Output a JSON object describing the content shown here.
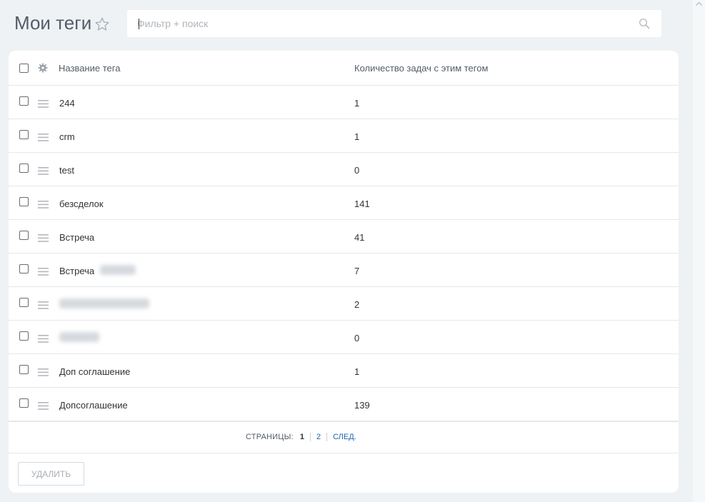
{
  "header": {
    "title": "Мои теги",
    "search_placeholder": "Фильтр + поиск",
    "search_value": ""
  },
  "table": {
    "columns": [
      "Название тега",
      "Количество задач с этим тегом"
    ],
    "rows": [
      {
        "name": "244",
        "count": "1"
      },
      {
        "name": "crm",
        "count": "1"
      },
      {
        "name": "test",
        "count": "0"
      },
      {
        "name": "безсделок",
        "count": "141"
      },
      {
        "name": "Встреча",
        "count": "41"
      },
      {
        "name": "Встреча",
        "count": "7"
      },
      {
        "name": "",
        "count": "2"
      },
      {
        "name": "",
        "count": "0"
      },
      {
        "name": "Доп соглашение",
        "count": "1"
      },
      {
        "name": "Допсоглашение",
        "count": "139"
      }
    ]
  },
  "pagination": {
    "label": "Страницы:",
    "current": "1",
    "pages": [
      "2"
    ],
    "next": "След."
  },
  "footer": {
    "delete_label": "Удалить"
  },
  "icons": [
    "star-icon",
    "search-icon",
    "gear-icon",
    "drag-handle-icon",
    "scroll-up-icon"
  ],
  "colors": {
    "background": "#eef2f4",
    "title": "#535c69",
    "link": "#2067b0",
    "border": "#e4e8eb"
  }
}
